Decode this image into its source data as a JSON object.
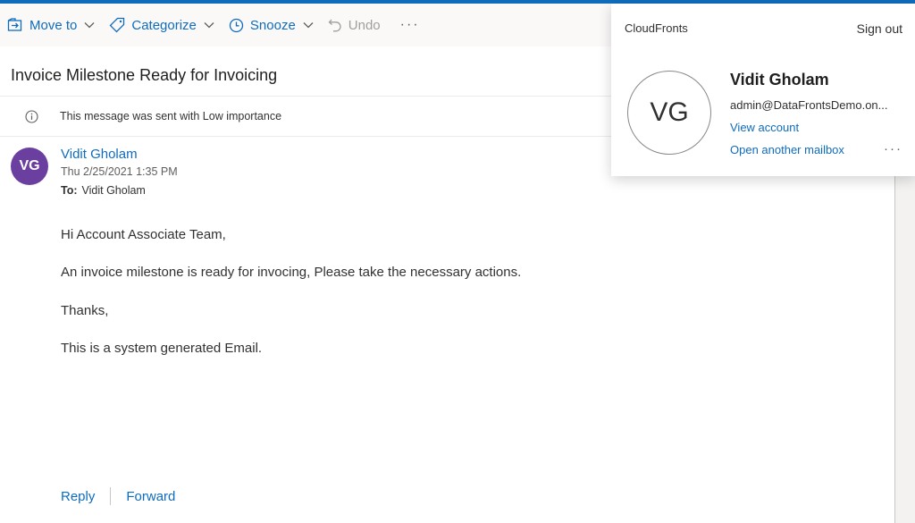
{
  "colors": {
    "accent": "#0f6cbd",
    "avatar_bg": "#6b3fa0"
  },
  "toolbar": {
    "move_to": "Move to",
    "categorize": "Categorize",
    "snooze": "Snooze",
    "undo": "Undo",
    "more": "···"
  },
  "message": {
    "subject": "Invoice Milestone Ready for Invoicing",
    "importance_notice": "This message was sent with Low importance",
    "sender_initials": "VG",
    "sender_name": "Vidit Gholam",
    "date": "Thu 2/25/2021 1:35 PM",
    "to_label": "To:",
    "to_value": "Vidit Gholam",
    "body": [
      "Hi Account Associate Team,",
      "An invoice milestone is ready for invocing, Please take the necessary actions.",
      "Thanks,",
      "This is a system generated Email."
    ],
    "reply": "Reply",
    "forward": "Forward"
  },
  "account_flyout": {
    "org": "CloudFronts",
    "sign_out": "Sign out",
    "initials": "VG",
    "name": "Vidit Gholam",
    "email": "admin@DataFrontsDemo.on...",
    "view_account": "View account",
    "open_another_mailbox": "Open another mailbox",
    "more": "···"
  }
}
